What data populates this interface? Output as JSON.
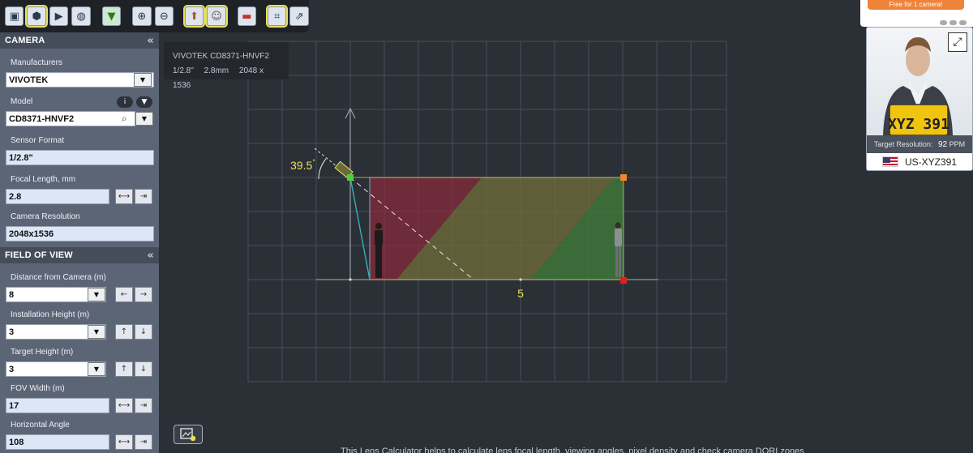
{
  "toolbar": {
    "buttons": [
      "cube-icon",
      "box-icon",
      "video-camera-icon",
      "sphere-icon",
      "marker-icon",
      "zoom-in-icon",
      "zoom-out-icon",
      "person-up-icon",
      "person-icon",
      "car-icon",
      "crop-icon",
      "share-icon"
    ]
  },
  "camera": {
    "section_title": "CAMERA",
    "manufacturers_label": "Manufacturers",
    "manufacturer": "VIVOTEK",
    "model_label": "Model",
    "model": "CD8371-HNVF2",
    "info_glyph": "i",
    "sensor_label": "Sensor Format",
    "sensor": "1/2.8\"",
    "focal_label": "Focal Length, mm",
    "focal": "2.8",
    "resolution_label": "Camera Resolution",
    "resolution": "2048x1536"
  },
  "fov": {
    "section_title": "FIELD OF VIEW",
    "distance_label": "Distance from Camera (m)",
    "distance": "8",
    "install_height_label": "Installation Height (m)",
    "install_height": "3",
    "target_height_label": "Target Height (m)",
    "target_height": "3",
    "fov_width_label": "FOV Width (m)",
    "fov_width": "17",
    "hangle_label": "Horizontal Angle",
    "hangle": "108"
  },
  "tooltip": {
    "title": "VIVOTEK CD8371-HNVF2",
    "sensor": "1/2.8\"",
    "focal": "2.8mm",
    "resolution": "2048 x 1536"
  },
  "scene": {
    "tilt_angle": "39.5",
    "degree_symbol": "°",
    "distance_marker": "5"
  },
  "promo": {
    "text": "Free for 1 camera!"
  },
  "target": {
    "resolution_label": "Target Resolution:",
    "resolution_value": "92",
    "resolution_unit": "PPM",
    "plate": "US-XYZ391",
    "plate_image_text": "XYZ 391"
  },
  "bottom_text": "This Lens Calculator helps to calculate lens focal length, viewing angles, pixel density and check camera DORI zones",
  "colors": {
    "accent": "#e8e25a",
    "fov_red": "#8b2a3a",
    "fov_green": "#3f7a3a",
    "fov_yellow": "#6d6a3a",
    "handle_orange": "#f0852a",
    "handle_red": "#e0201e",
    "handle_green": "#4cd040"
  }
}
